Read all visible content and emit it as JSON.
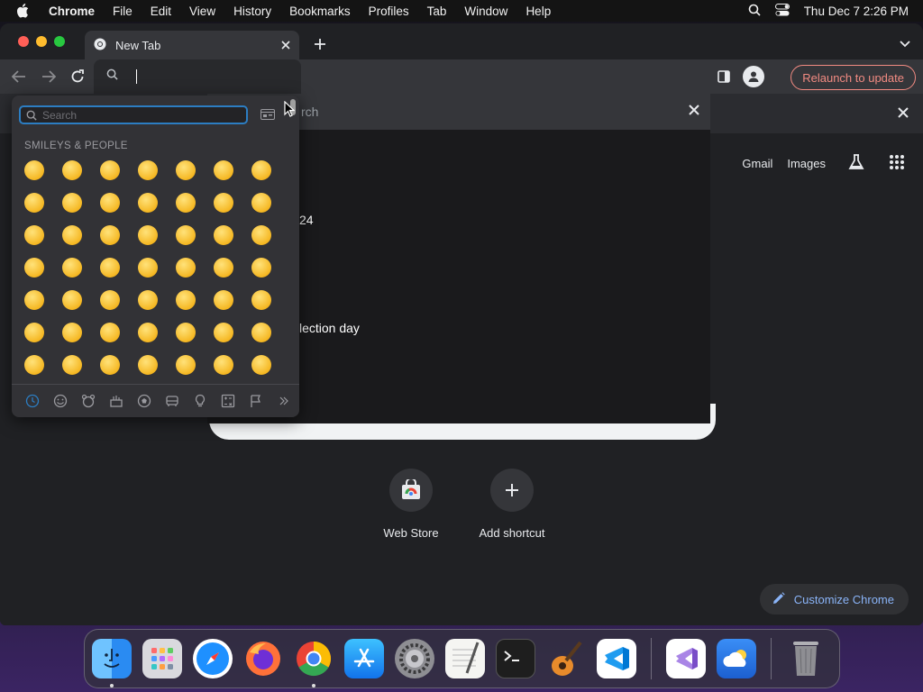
{
  "menubar": {
    "app": "Chrome",
    "items": [
      "File",
      "Edit",
      "View",
      "History",
      "Bookmarks",
      "Profiles",
      "Tab",
      "Window",
      "Help"
    ],
    "clock": "Thu Dec 7  2:26 PM"
  },
  "tab": {
    "title": "New Tab"
  },
  "toolbar": {
    "relaunch_label": "Relaunch to update"
  },
  "dropdown": {
    "placeholder_fragment": "rch"
  },
  "ntp": {
    "links": {
      "gmail": "Gmail",
      "images": "Images"
    },
    "doodle_text_1": "24",
    "doodle_text_2": "lection day",
    "shortcuts": [
      {
        "label": "Web Store"
      },
      {
        "label": "Add shortcut"
      }
    ],
    "customize_label": "Customize Chrome"
  },
  "emoji_picker": {
    "search_placeholder": "Search",
    "category_title": "SMILEYS & PEOPLE",
    "emoji_rows": [
      [
        "😀",
        "😃",
        "😄",
        "😁",
        "😆",
        "🥹",
        "😅"
      ],
      [
        "😂",
        "🤣",
        "🥲",
        "☺️",
        "😊",
        "😇",
        "🙂"
      ],
      [
        "🙃",
        "😉",
        "😌",
        "😍",
        "🥰",
        "😘",
        "😗"
      ],
      [
        "😙",
        "😚",
        "😋",
        "😛",
        "😝",
        "😜",
        "🤪"
      ],
      [
        "🤨",
        "🧐",
        "🤓",
        "😎",
        "🥸",
        "🤩",
        "🥳"
      ],
      [
        "😏",
        "😒",
        "😞",
        "😔",
        "😟",
        "😕",
        "🙁"
      ],
      [
        "☹️",
        "😣",
        "😖",
        "😫",
        "😩",
        "🥺",
        "😢"
      ]
    ],
    "category_icons": [
      "clock-icon",
      "smiley-icon",
      "animal-icon",
      "food-icon",
      "ball-icon",
      "car-icon",
      "bulb-icon",
      "symbols-icon",
      "flag-icon",
      "more-icon"
    ]
  },
  "dock": {
    "apps": [
      "Finder",
      "Launchpad",
      "Safari",
      "Firefox",
      "Chrome",
      "App Store",
      "System Settings",
      "TextEdit",
      "Terminal",
      "GarageBand",
      "Visual Studio Code",
      "Visual Studio",
      "Weather",
      "Trash"
    ]
  },
  "colors": {
    "accent_blue": "#8ab4f8",
    "relaunch_red": "#f28b82",
    "picker_bg": "#323236"
  }
}
